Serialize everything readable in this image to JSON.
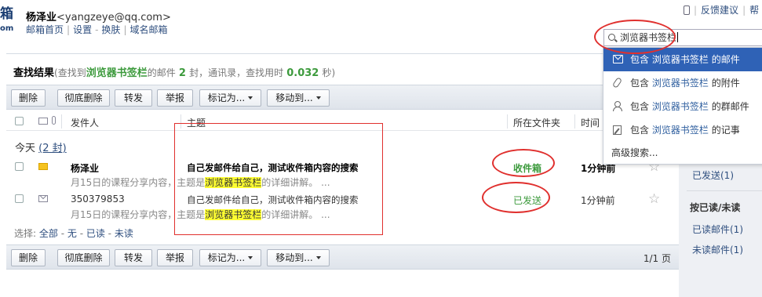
{
  "header": {
    "logo_line1": "箱",
    "logo_line2": "om",
    "user_name": "杨泽业",
    "user_email": "<yangzeye@qq.com>",
    "links": [
      "邮箱首页",
      "设置",
      "换肤",
      "域名邮箱"
    ],
    "top_right": [
      "反馈建议",
      "帮"
    ]
  },
  "search": {
    "query": "浏览器书签栏",
    "suggestions": [
      {
        "prefix": "包含",
        "term": "浏览器书签栏",
        "suffix": "的邮件",
        "icon": "envelope-icon"
      },
      {
        "prefix": "包含",
        "term": "浏览器书签栏",
        "suffix": "的附件",
        "icon": "paperclip-icon"
      },
      {
        "prefix": "包含",
        "term": "浏览器书签栏",
        "suffix": "的群邮件",
        "icon": "group-icon"
      },
      {
        "prefix": "包含",
        "term": "浏览器书签栏",
        "suffix": "的记事",
        "icon": "note-icon"
      }
    ],
    "advanced": "高级搜索..."
  },
  "results": {
    "title": "查找结果",
    "desc_prefix": "(查找到",
    "desc_term": "浏览器书签栏",
    "desc_mid": "的邮件",
    "count": "2",
    "desc_mid2": "封，通讯录，查找用时",
    "elapsed": "0.032",
    "desc_suffix": "秒)"
  },
  "toolbar": {
    "delete": "删除",
    "delete_forever": "彻底删除",
    "forward": "转发",
    "report": "举报",
    "mark_as": "标记为...",
    "move_to": "移动到...",
    "pager": "1/1 页"
  },
  "columns": {
    "sender": "发件人",
    "subject": "主题",
    "folder": "所在文件夹",
    "time": "时间"
  },
  "group": {
    "label": "今天",
    "count": "(2 封)"
  },
  "mails": [
    {
      "sender": "杨泽业",
      "subject": "自己发邮件给自己，测试收件箱内容的搜索",
      "preview_a": "月15日的课程分享内容，主题是",
      "preview_term": "浏览器书签栏",
      "preview_b": "的详细讲解。 ...",
      "folder": "收件箱",
      "folder_color": "#3c9a3c",
      "time": "1分钟前",
      "unread": true
    },
    {
      "sender": "350379853",
      "subject": "自己发邮件给自己，测试收件箱内容的搜索",
      "preview_a": "月15日的课程分享内容，主题是",
      "preview_term": "浏览器书签栏",
      "preview_b": "的详细讲解。 ...",
      "folder": "已发送",
      "folder_color": "#3c9a3c",
      "time": "1分钟前",
      "unread": false
    }
  ],
  "select_bar": {
    "label": "选择:",
    "all": "全部",
    "none": "无",
    "read": "已读",
    "unread": "未读"
  },
  "right_panel": {
    "sent": "已发送(1)",
    "heading": "按已读/未读",
    "read": "已读邮件(1)",
    "unread": "未读邮件(1)"
  },
  "colors": {
    "accent_blue": "#2f62b6",
    "annotation_red": "#e0302e",
    "highlight_yellow": "#ffff33",
    "green": "#3c9a3c"
  }
}
